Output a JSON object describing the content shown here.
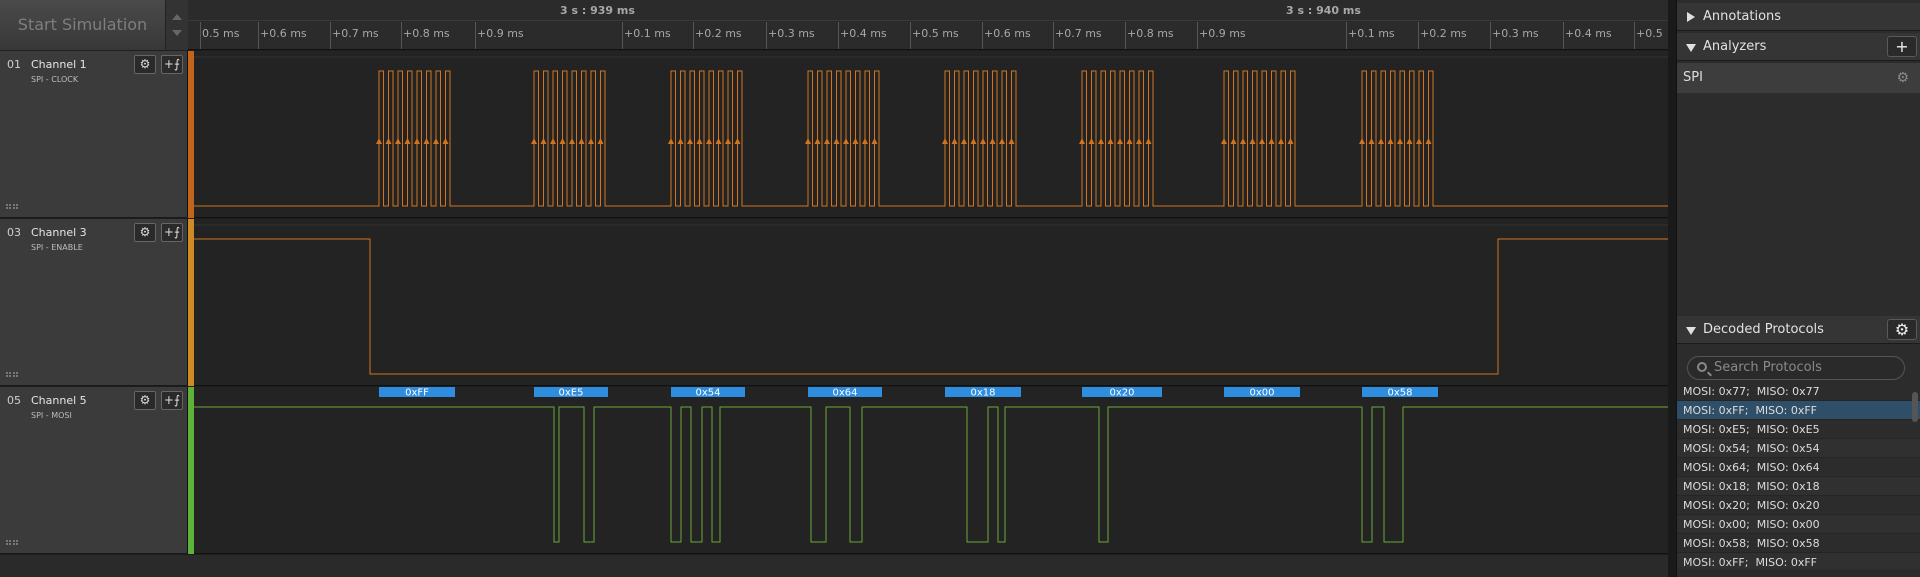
{
  "toolbar": {
    "start_label": "Start Simulation"
  },
  "ruler": {
    "major_labels": [
      "3 s : 939 ms",
      "3 s : 940 ms"
    ],
    "minor_labels": [
      "0.5 ms",
      "+0.6 ms",
      "+0.7 ms",
      "+0.8 ms",
      "+0.9 ms",
      "+0.1 ms",
      "+0.2 ms",
      "+0.3 ms",
      "+0.4 ms",
      "+0.5 ms",
      "+0.6 ms",
      "+0.7 ms",
      "+0.8 ms",
      "+0.9 ms",
      "+0.1 ms",
      "+0.2 ms",
      "+0.3 ms",
      "+0.4 ms",
      "+0.5"
    ]
  },
  "channels": [
    {
      "num": "01",
      "name": "Channel 1",
      "sub": "SPI - CLOCK",
      "color": "#c0651b",
      "wave_color": "#d2741f"
    },
    {
      "num": "03",
      "name": "Channel 3",
      "sub": "SPI - ENABLE",
      "color": "#d08a23",
      "wave_color": "#d2741f"
    },
    {
      "num": "05",
      "name": "Channel 5",
      "sub": "SPI - MOSI",
      "color": "#5db33a",
      "wave_color": "#6aa83a"
    }
  ],
  "channel_buttons": {
    "gear": "⚙",
    "trigger": "+⨍"
  },
  "decoded_bytes": [
    "0xFF",
    "0xE5",
    "0x54",
    "0x64",
    "0x18",
    "0x20",
    "0x00",
    "0x58"
  ],
  "panel": {
    "annotations_title": "Annotations",
    "analyzers_title": "Analyzers",
    "add_label": "+",
    "analyzer_name": "SPI",
    "decoded_title": "Decoded Protocols",
    "search_placeholder": "Search Protocols",
    "protocols": [
      "MOSI: 0x77;  MISO: 0x77",
      "MOSI: 0xFF;  MISO: 0xFF",
      "MOSI: 0xE5;  MISO: 0xE5",
      "MOSI: 0x54;  MISO: 0x54",
      "MOSI: 0x64;  MISO: 0x64",
      "MOSI: 0x18;  MISO: 0x18",
      "MOSI: 0x20;  MISO: 0x20",
      "MOSI: 0x00;  MISO: 0x00",
      "MOSI: 0x58;  MISO: 0x58",
      "MOSI: 0xFF;  MISO: 0xFF"
    ],
    "selected_index": 1
  },
  "icons": {
    "gear": "gear-icon",
    "search": "search-icon"
  }
}
